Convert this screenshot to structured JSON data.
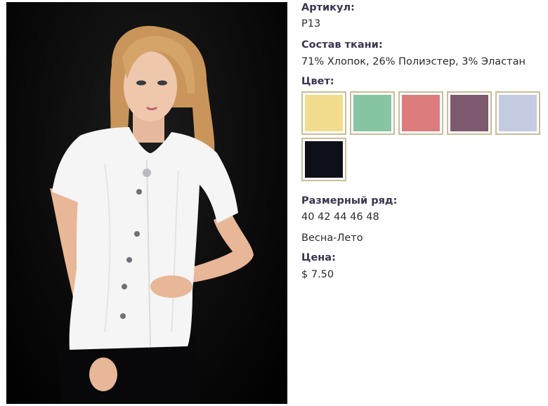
{
  "product": {
    "photo_alt": "product-photo",
    "article_label": "Артикул:",
    "article_value": "P13",
    "fabric_label": "Состав ткани:",
    "fabric_value": "71% Хлопок, 26% Полиэстер, 3% Эластан",
    "color_label": "Цвет:",
    "colors": [
      {
        "name": "yellow",
        "hex": "#f2dd8e"
      },
      {
        "name": "mint-green",
        "hex": "#86c5a1"
      },
      {
        "name": "coral-pink",
        "hex": "#dd7c7d"
      },
      {
        "name": "mauve",
        "hex": "#7d5a6d"
      },
      {
        "name": "light-blue-gray",
        "hex": "#c4cbe0"
      },
      {
        "name": "black",
        "hex": "#0d1018"
      }
    ],
    "size_label": "Размерный ряд:",
    "size_value": "40 42 44 46 48",
    "season_value": "Весна-Лето",
    "price_label": "Цена:",
    "price_value": "$ 7.50"
  }
}
